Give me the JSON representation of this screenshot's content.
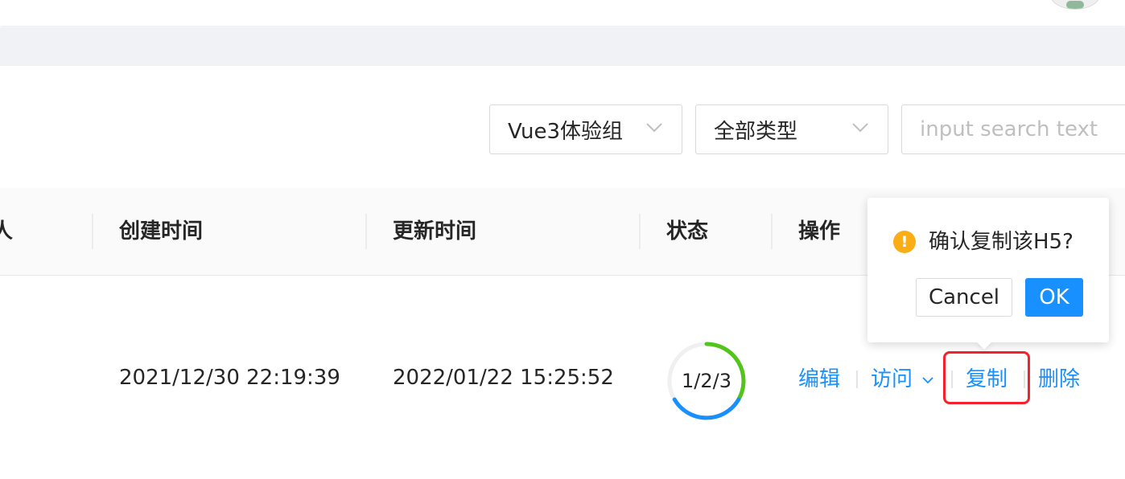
{
  "filters": {
    "group_select": {
      "value": "Vue3体验组"
    },
    "type_select": {
      "value": "全部类型"
    },
    "search": {
      "placeholder": "input search text"
    }
  },
  "table": {
    "columns": [
      "人",
      "创建时间",
      "更新时间",
      "状态",
      "操作"
    ],
    "rows": [
      {
        "created_at": "2021/12/30 22:19:39",
        "updated_at": "2022/01/22 15:25:52",
        "status": "1/2/3",
        "actions": [
          "编辑",
          "访问",
          "复制",
          "删除"
        ]
      }
    ]
  },
  "popconfirm": {
    "message": "确认复制该H5?",
    "cancel_label": "Cancel",
    "ok_label": "OK"
  },
  "icons": {
    "warning": "exclamation-circle-icon",
    "dropdown": "chevron-down-icon"
  },
  "colors": {
    "primary": "#1890ff",
    "warning": "#faad14",
    "highlight_border": "#f5222d",
    "status_green": "#52c41a",
    "status_blue": "#1890ff"
  }
}
